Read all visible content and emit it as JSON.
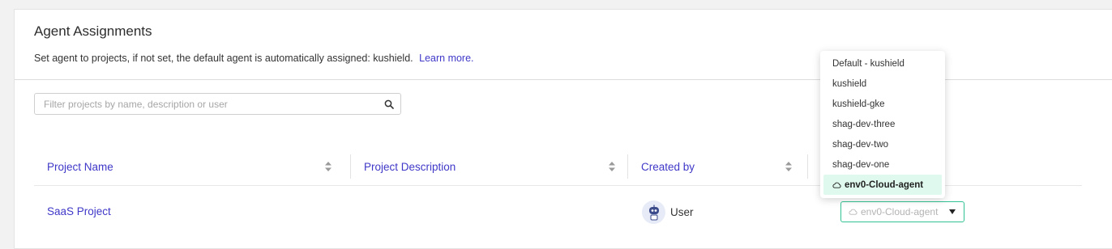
{
  "panel": {
    "title": "Agent Assignments",
    "subtitle": "Set agent to projects, if not set, the default agent is automatically assigned: kushield.",
    "learn_more": "Learn more."
  },
  "search": {
    "placeholder": "Filter projects by name, description or user",
    "value": ""
  },
  "table": {
    "columns": [
      "Project Name",
      "Project Description",
      "Created by"
    ],
    "rows": [
      {
        "project_name": "SaaS Project",
        "description": "",
        "created_by": "User",
        "agent": "env0-Cloud-agent"
      }
    ]
  },
  "agent_dropdown": {
    "options": [
      "Default - kushield",
      "kushield",
      "kushield-gke",
      "shag-dev-three",
      "shag-dev-two",
      "shag-dev-one",
      "env0-Cloud-agent"
    ],
    "selected": "env0-Cloud-agent",
    "accent_color": "#33c295"
  },
  "colors": {
    "link": "#3f38c8",
    "selected_bg": "#dff9ee"
  },
  "icons": {
    "search": "search-icon",
    "sort": "sort-icon",
    "cloud": "cloud-icon",
    "caret": "caret-down-icon",
    "avatar": "robot-avatar-icon"
  }
}
